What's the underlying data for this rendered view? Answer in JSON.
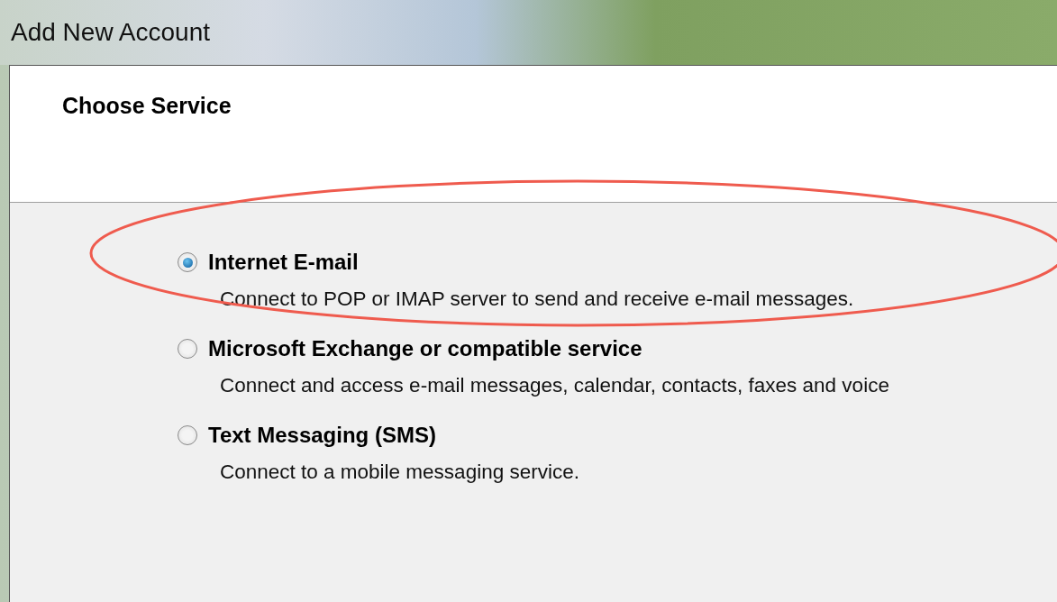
{
  "window": {
    "title": "Add New Account"
  },
  "header": {
    "title": "Choose Service"
  },
  "options": [
    {
      "label": "Internet E-mail",
      "description": "Connect to POP or IMAP server to send and receive e-mail messages.",
      "selected": true
    },
    {
      "label": "Microsoft Exchange or compatible service",
      "description": "Connect and access e-mail messages, calendar, contacts, faxes and voice",
      "selected": false
    },
    {
      "label": "Text Messaging (SMS)",
      "description": "Connect to a mobile messaging service.",
      "selected": false
    }
  ]
}
